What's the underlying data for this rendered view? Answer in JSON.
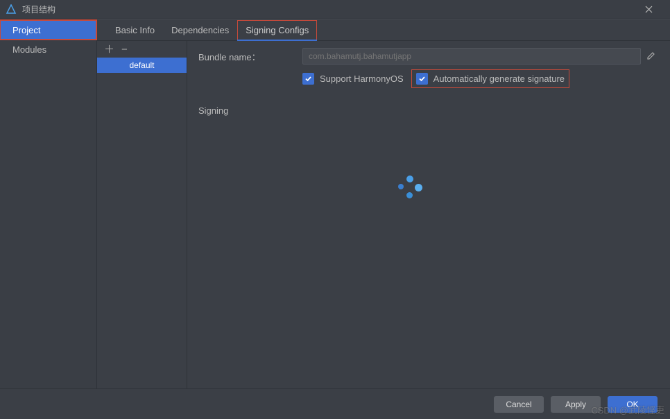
{
  "window": {
    "title": "项目结构"
  },
  "leftNav": {
    "items": [
      {
        "label": "Project",
        "selected": true,
        "highlighted": true
      },
      {
        "label": "Modules",
        "selected": false,
        "highlighted": false
      }
    ]
  },
  "tabs": [
    {
      "label": "Basic Info",
      "active": false,
      "highlighted": false
    },
    {
      "label": "Dependencies",
      "active": false,
      "highlighted": false
    },
    {
      "label": "Signing Configs",
      "active": true,
      "highlighted": true
    }
  ],
  "configList": {
    "items": [
      {
        "label": "default",
        "selected": true
      }
    ]
  },
  "form": {
    "bundleNameLabel": "Bundle name：",
    "bundleNamePlaceholder": "com.bahamutj.bahamutjapp",
    "supportHarmonyLabel": "Support HarmonyOS",
    "supportHarmonyChecked": true,
    "autoGenLabel": "Automatically generate signature",
    "autoGenChecked": true,
    "autoGenHighlighted": true,
    "signingLabel": "Signing"
  },
  "buttons": {
    "cancel": "Cancel",
    "apply": "Apply",
    "ok": "OK"
  },
  "watermark": "CSDN @武陵悭吏",
  "colors": {
    "accent": "#3D6FD1",
    "highlight": "#C94A3A",
    "background": "#3B3F46"
  }
}
